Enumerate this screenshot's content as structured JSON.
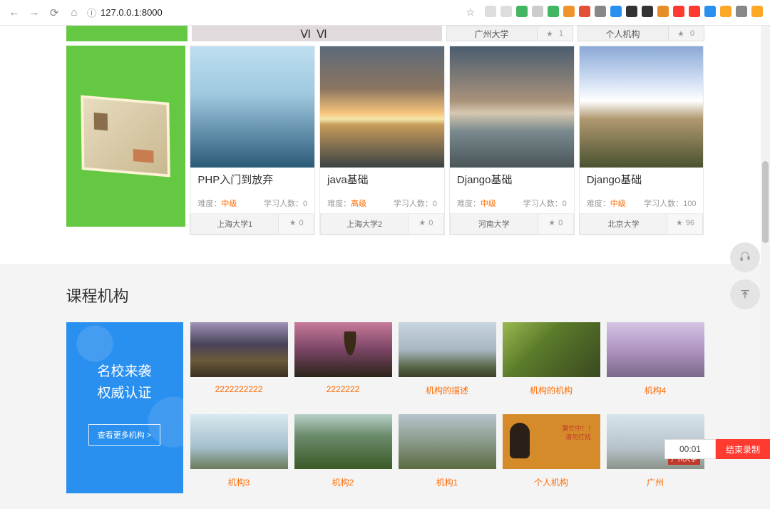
{
  "browser": {
    "url": "127.0.0.1:8000",
    "ext_colors": [
      "#ddd",
      "#ddd",
      "#43b661",
      "#ccc",
      "#43b661",
      "#f0932b",
      "#e55039",
      "#888",
      "#2a90ef",
      "#333",
      "#333",
      "#e58e26",
      "#ff3a30",
      "#ff3a30",
      "#2a90ef",
      "#ffa726",
      "#888",
      "#ffa726"
    ]
  },
  "top_orgs": [
    {
      "name": "广州大学",
      "count": "1"
    },
    {
      "name": "个人机构",
      "count": "0"
    }
  ],
  "courses": [
    {
      "title": "PHP入门到放弃",
      "diff_label": "难度：",
      "level": "中级",
      "learn_label": "学习人数：",
      "learners": "0",
      "org": "上海大学1",
      "stars": "0",
      "img": "img-ice"
    },
    {
      "title": "java基础",
      "diff_label": "难度：",
      "level": "高级",
      "learn_label": "学习人数：",
      "learners": "0",
      "org": "上海大学2",
      "stars": "0",
      "img": "img-sunset1"
    },
    {
      "title": "Django基础",
      "diff_label": "难度：",
      "level": "中级",
      "learn_label": "学习人数：",
      "learners": "0",
      "org": "河南大学",
      "stars": "0",
      "img": "img-boats"
    },
    {
      "title": "Django基础",
      "diff_label": "难度：",
      "level": "中级",
      "learn_label": "学习人数：",
      "learners": "100",
      "org": "北京大学",
      "stars": "96",
      "img": "img-mtn"
    }
  ],
  "section2": {
    "title": "课程机构",
    "panel_line1": "名校来袭",
    "panel_line2": "权威认证",
    "panel_btn": "查看更多机构 >"
  },
  "orgs": [
    {
      "name": "2222222222",
      "img": "oi1"
    },
    {
      "name": "2222222",
      "img": "oi2"
    },
    {
      "name": "机构的描述",
      "img": "oi3"
    },
    {
      "name": "机构的机构",
      "img": "oi4"
    },
    {
      "name": "机构4",
      "img": "oi5"
    },
    {
      "name": "机构3",
      "img": "oi6"
    },
    {
      "name": "机构2",
      "img": "oi7"
    },
    {
      "name": "机构1",
      "img": "oi8"
    },
    {
      "name": "个人机构",
      "img": "oi9",
      "busy_l1": "繁忙中！！",
      "busy_l2": "请勿打扰"
    },
    {
      "name": "广州",
      "img": "oi10",
      "tag": "广州大学"
    }
  ],
  "recorder": {
    "time": "00:01",
    "stop": "结束录制"
  }
}
